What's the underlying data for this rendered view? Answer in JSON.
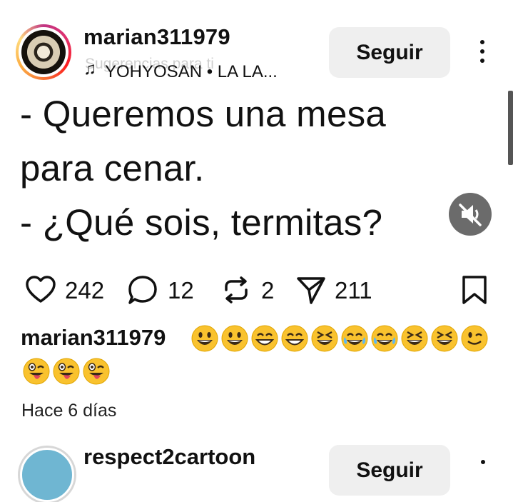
{
  "header": {
    "username": "marian311979",
    "suggestion_text": "Sugerencias para ti",
    "track": "YOHYOSAN • LA LA...",
    "follow_label": "Seguir"
  },
  "post": {
    "lines": [
      "- Queremos una mesa",
      "para cenar.",
      "- ¿Qué sois, termitas?"
    ]
  },
  "actions": {
    "likes": "242",
    "comments": "12",
    "reposts": "2",
    "shares": "211"
  },
  "caption": {
    "username": "marian311979",
    "emojis_row1": [
      "grinning",
      "smiley",
      "grin",
      "beaming",
      "laughing",
      "rofl",
      "joy",
      "laughing",
      "laughing",
      "wink"
    ],
    "emojis_row2": [
      "tongue-wink",
      "tongue-wink",
      "tongue-wink"
    ],
    "time": "Hace 6 días"
  },
  "next_post": {
    "username": "respect2cartoon",
    "follow_label": "Seguir"
  },
  "colors": {
    "background": "#ffffff",
    "button_bg": "#efefef",
    "text": "#111111",
    "muted": "#cfcfcf",
    "emoji_yellow": "#f9c22e"
  }
}
